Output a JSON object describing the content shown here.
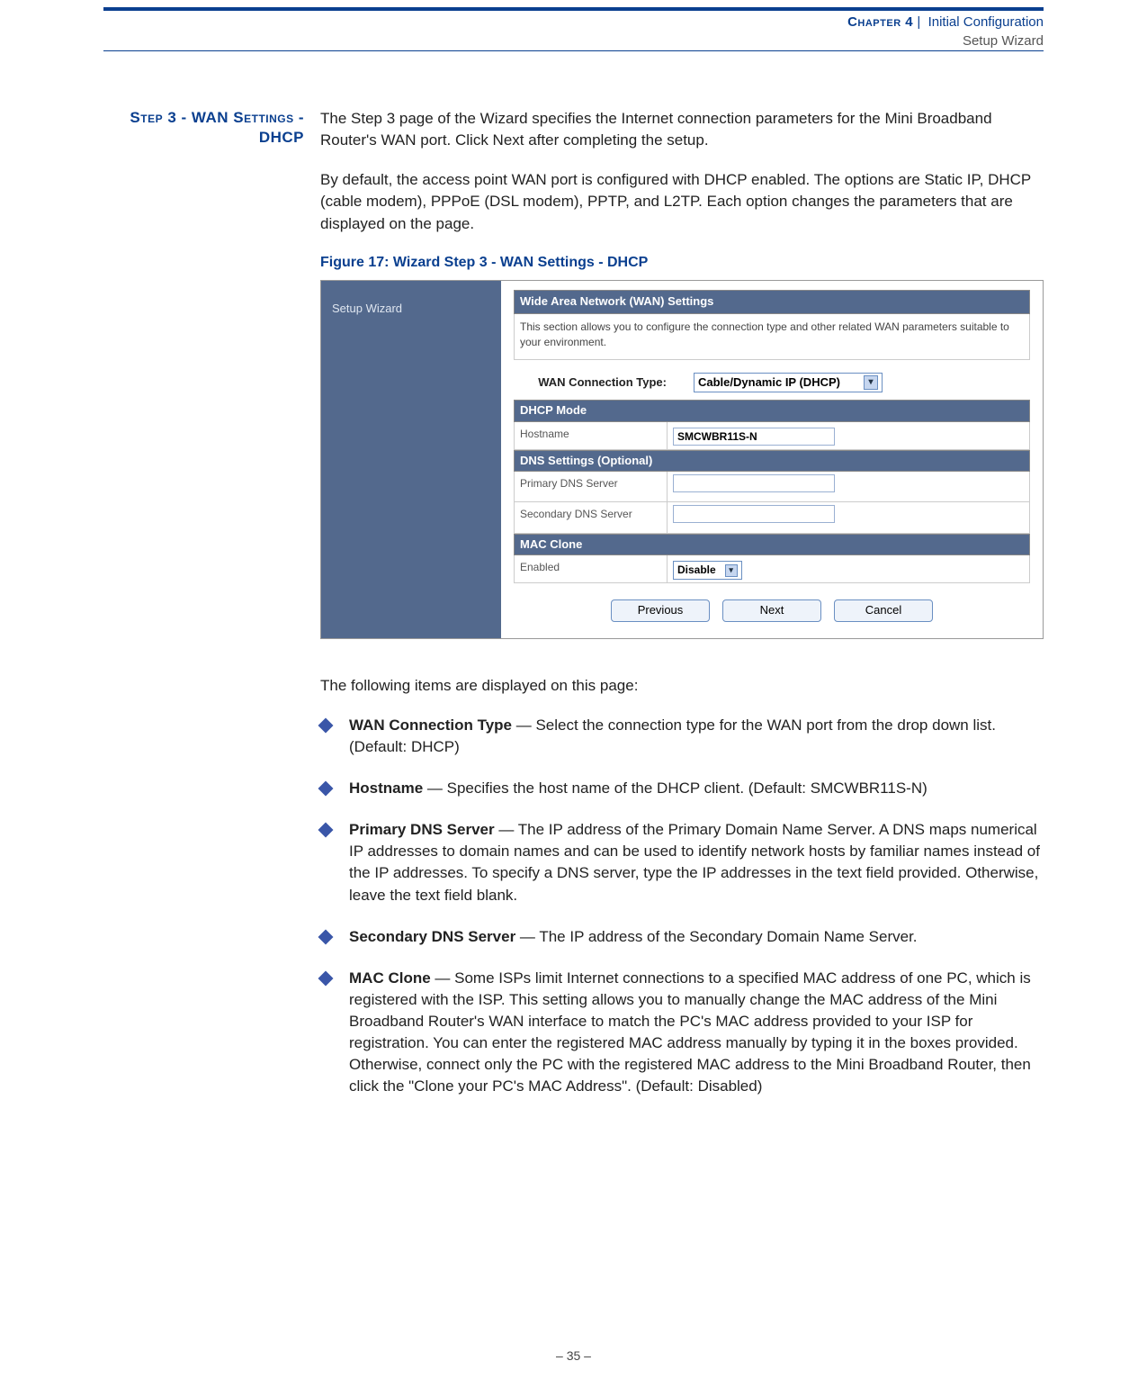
{
  "header": {
    "chapter": "Chapter 4",
    "separator": "|",
    "title": "Initial Configuration",
    "subtitle": "Setup Wizard"
  },
  "side_heading": "Step 3 - WAN Settings - DHCP",
  "paras": {
    "p1": "The Step 3 page of the Wizard specifies the Internet connection parameters for the Mini Broadband Router's WAN port. Click Next after completing the setup.",
    "p2": "By default, the access point WAN port is configured with DHCP enabled. The options are Static IP, DHCP (cable modem), PPPoE (DSL modem), PPTP, and L2TP. Each option changes the parameters that are displayed on the page."
  },
  "figure_caption": "Figure 17:  Wizard Step 3 - WAN Settings - DHCP",
  "wizard": {
    "sidebar_label": "Setup Wizard",
    "panel_title": "Wide Area Network (WAN) Settings",
    "panel_desc": "This section allows you to configure the connection type and other related WAN parameters suitable to your environment.",
    "conn_label": "WAN Connection Type:",
    "conn_value": "Cable/Dynamic IP (DHCP)",
    "dhcp_section": "DHCP Mode",
    "hostname_label": "Hostname",
    "hostname_value": "SMCWBR11S-N",
    "dns_section": "DNS Settings (Optional)",
    "primary_dns_label": "Primary DNS Server",
    "primary_dns_value": "",
    "secondary_dns_label": "Secondary DNS Server",
    "secondary_dns_value": "",
    "mac_section": "MAC Clone",
    "mac_enabled_label": "Enabled",
    "mac_enabled_value": "Disable",
    "btn_prev": "Previous",
    "btn_next": "Next",
    "btn_cancel": "Cancel"
  },
  "intro_list": "The following items are displayed on this page:",
  "bullets": [
    {
      "term": "WAN Connection Type",
      "desc": " — Select the connection type for the WAN port from the drop down list. (Default: DHCP)"
    },
    {
      "term": "Hostname",
      "desc": " — Specifies the host name of the DHCP client. (Default: SMCWBR11S-N)"
    },
    {
      "term": "Primary DNS Server",
      "desc": " — The IP address of the Primary Domain Name Server. A DNS maps numerical IP addresses to domain names and can be used to identify network hosts by familiar names instead of the IP addresses. To specify a DNS server, type the IP addresses in the text field provided. Otherwise, leave the text field blank."
    },
    {
      "term": "Secondary DNS Server",
      "desc": " — The IP address of the Secondary Domain Name Server."
    },
    {
      "term": "MAC Clone",
      "desc": " — Some ISPs limit Internet connections to a specified MAC address of one PC, which is registered with the ISP. This setting allows you to manually change the MAC address of the Mini Broadband Router's WAN interface to match the PC's MAC address provided to your ISP for registration. You can enter the registered MAC address manually by typing it in the boxes provided. Otherwise, connect only the PC with the registered MAC address to the Mini Broadband Router, then click the \"Clone your PC's MAC Address\". (Default: Disabled)"
    }
  ],
  "footer": "–  35  –"
}
